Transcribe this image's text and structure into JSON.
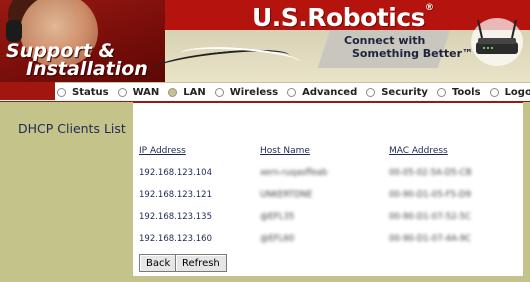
{
  "header": {
    "support_line1": "Support &",
    "support_line2": "Installation",
    "brand": "U.S.Robotics",
    "brand_reg": "®",
    "tagline_line1": "Connect with",
    "tagline_line2": "Something Better™"
  },
  "nav": {
    "items": [
      {
        "label": "Status",
        "active": false
      },
      {
        "label": "WAN",
        "active": false
      },
      {
        "label": "LAN",
        "active": true
      },
      {
        "label": "Wireless",
        "active": false
      },
      {
        "label": "Advanced",
        "active": false
      },
      {
        "label": "Security",
        "active": false
      },
      {
        "label": "Tools",
        "active": false
      },
      {
        "label": "Logout",
        "active": false
      }
    ]
  },
  "sidebar": {
    "title": "DHCP Clients List"
  },
  "table": {
    "headers": [
      "IP Address",
      "Host Name",
      "MAC Address"
    ],
    "rows": [
      [
        "192.168.123.104",
        "xern-ruqasffeab",
        "00-05-02-5A-D5-CB"
      ],
      [
        "192.168.123.121",
        "UNKERTDNE",
        "00-90-D1-05-F5-D9"
      ],
      [
        "192.168.123.135",
        "@EFL35",
        "00-90-D1-07-52-5C"
      ],
      [
        "192.168.123.160",
        "@EFL60",
        "00-90-D1-07-4A-9C"
      ]
    ]
  },
  "buttons": {
    "back": "Back",
    "refresh": "Refresh"
  },
  "colors": {
    "brand_red": "#a11710",
    "sidebar_olive": "#c4c48a",
    "text_navy": "#1d2a55"
  }
}
